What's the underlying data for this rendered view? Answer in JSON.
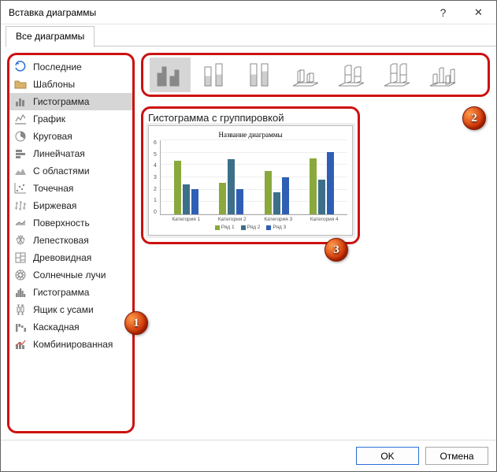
{
  "window": {
    "title": "Вставка диаграммы",
    "help": "?",
    "close": "✕"
  },
  "tabs": {
    "all": "Все диаграммы"
  },
  "sidebar": {
    "items": [
      {
        "label": "Последние"
      },
      {
        "label": "Шаблоны"
      },
      {
        "label": "Гистограмма"
      },
      {
        "label": "График"
      },
      {
        "label": "Круговая"
      },
      {
        "label": "Линейчатая"
      },
      {
        "label": "С областями"
      },
      {
        "label": "Точечная"
      },
      {
        "label": "Биржевая"
      },
      {
        "label": "Поверхность"
      },
      {
        "label": "Лепестковая"
      },
      {
        "label": "Древовидная"
      },
      {
        "label": "Солнечные лучи"
      },
      {
        "label": "Гистограмма"
      },
      {
        "label": "Ящик с усами"
      },
      {
        "label": "Каскадная"
      },
      {
        "label": "Комбинированная"
      }
    ]
  },
  "preview": {
    "title": "Гистограмма с группировкой",
    "chart_title": "Название диаграммы"
  },
  "chart_data": {
    "type": "bar",
    "categories": [
      "Категория 1",
      "Категория 2",
      "Категория 3",
      "Категория 4"
    ],
    "series": [
      {
        "name": "Ряд 1",
        "values": [
          4.3,
          2.5,
          3.5,
          4.5
        ],
        "color": "#8aa93d"
      },
      {
        "name": "Ряд 2",
        "values": [
          2.4,
          4.4,
          1.8,
          2.8
        ],
        "color": "#3d6f8a"
      },
      {
        "name": "Ряд 3",
        "values": [
          2.0,
          2.0,
          3.0,
          5.0
        ],
        "color": "#2f5fb4"
      }
    ],
    "ylim": [
      0,
      6
    ],
    "yticks": [
      0,
      1,
      2,
      3,
      4,
      5,
      6
    ],
    "title": "Название диаграммы"
  },
  "badges": {
    "b1": "1",
    "b2": "2",
    "b3": "3"
  },
  "buttons": {
    "ok": "OK",
    "cancel": "Отмена"
  }
}
